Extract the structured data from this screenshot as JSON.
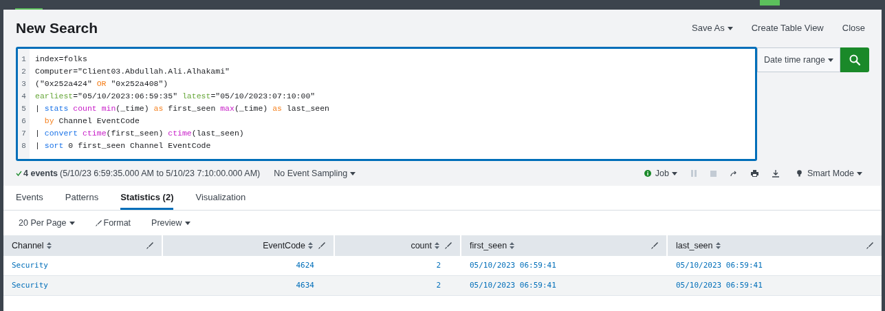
{
  "header": {
    "title": "New Search",
    "actions": [
      {
        "label": "Save As",
        "dropdown": true
      },
      {
        "label": "Create Table View",
        "dropdown": false
      },
      {
        "label": "Close",
        "dropdown": false
      }
    ]
  },
  "search": {
    "lines": [
      {
        "number": "1",
        "tokens": [
          {
            "text": "index=folks",
            "kind": "plain"
          }
        ]
      },
      {
        "number": "2",
        "tokens": [
          {
            "text": "Computer=\"Client03.Abdullah.Ali.Alhakami\"",
            "kind": "plain"
          }
        ]
      },
      {
        "number": "3",
        "tokens": [
          {
            "text": "(\"0x252a424\" ",
            "kind": "plain"
          },
          {
            "text": "OR",
            "kind": "operator"
          },
          {
            "text": " \"0x252a408\")",
            "kind": "plain"
          }
        ]
      },
      {
        "number": "4",
        "tokens": [
          {
            "text": "earliest",
            "kind": "modifier"
          },
          {
            "text": "=\"05/10/2023:06:59:35\" ",
            "kind": "plain"
          },
          {
            "text": "latest",
            "kind": "modifier"
          },
          {
            "text": "=\"05/10/2023:07:10:00\"",
            "kind": "plain"
          }
        ]
      },
      {
        "number": "5",
        "tokens": [
          {
            "text": "| ",
            "kind": "plain"
          },
          {
            "text": "stats",
            "kind": "command"
          },
          {
            "text": " count",
            "kind": "function"
          },
          {
            "text": " min",
            "kind": "function"
          },
          {
            "text": "(_time) ",
            "kind": "plain"
          },
          {
            "text": "as",
            "kind": "operator"
          },
          {
            "text": " first_seen ",
            "kind": "plain"
          },
          {
            "text": "max",
            "kind": "function"
          },
          {
            "text": "(_time) ",
            "kind": "plain"
          },
          {
            "text": "as",
            "kind": "operator"
          },
          {
            "text": " last_seen",
            "kind": "plain"
          }
        ]
      },
      {
        "number": "6",
        "tokens": [
          {
            "text": "  by",
            "kind": "operator"
          },
          {
            "text": " Channel EventCode",
            "kind": "plain"
          }
        ]
      },
      {
        "number": "7",
        "tokens": [
          {
            "text": "| ",
            "kind": "plain"
          },
          {
            "text": "convert",
            "kind": "command"
          },
          {
            "text": " ctime",
            "kind": "function"
          },
          {
            "text": "(first_seen) ",
            "kind": "plain"
          },
          {
            "text": "ctime",
            "kind": "function"
          },
          {
            "text": "(last_seen)",
            "kind": "plain"
          }
        ]
      },
      {
        "number": "8",
        "tokens": [
          {
            "text": "| ",
            "kind": "plain"
          },
          {
            "text": "sort",
            "kind": "command"
          },
          {
            "text": " 0 first_seen Channel EventCode",
            "kind": "plain"
          }
        ]
      }
    ],
    "time_range": "Date time range"
  },
  "status": {
    "events": "4 events",
    "range": "(5/10/23 6:59:35.000 AM to 5/10/23 7:10:00.000 AM)",
    "sampling": "No Event Sampling",
    "job": "Job",
    "mode": "Smart Mode"
  },
  "tabs": [
    {
      "label": "Events",
      "selected": false
    },
    {
      "label": "Patterns",
      "selected": false
    },
    {
      "label": "Statistics (2)",
      "selected": true
    },
    {
      "label": "Visualization",
      "selected": false
    }
  ],
  "toolbar": {
    "per_page": "20 Per Page",
    "format": "Format",
    "preview": "Preview"
  },
  "table": {
    "columns": [
      {
        "label": "Channel",
        "kind": "text"
      },
      {
        "label": "EventCode",
        "kind": "number"
      },
      {
        "label": "count",
        "kind": "number"
      },
      {
        "label": "first_seen",
        "kind": "text"
      },
      {
        "label": "last_seen",
        "kind": "text"
      }
    ],
    "rows": [
      [
        "Security",
        "4624",
        "2",
        "05/10/2023 06:59:41",
        "05/10/2023 06:59:41"
      ],
      [
        "Security",
        "4634",
        "2",
        "05/10/2023 06:59:41",
        "05/10/2023 06:59:41"
      ]
    ]
  }
}
